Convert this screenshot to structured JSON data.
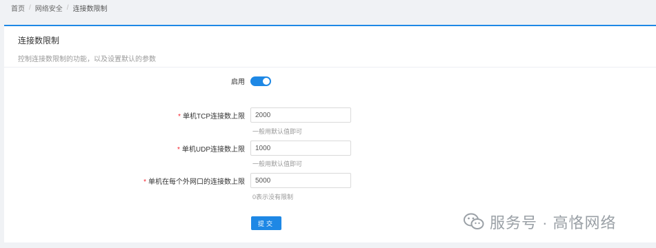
{
  "breadcrumb": {
    "items": [
      "首页",
      "网络安全",
      "连接数限制"
    ],
    "separator": "/"
  },
  "panel": {
    "title": "连接数限制",
    "description": "控制连接数限制的功能，以及设置默认的参数"
  },
  "form": {
    "enable": {
      "label": "启用",
      "value": true
    },
    "tcp": {
      "required_mark": "*",
      "label": "单机TCP连接数上限",
      "value": "2000",
      "hint": "一般用默认值即可"
    },
    "udp": {
      "required_mark": "*",
      "label": "单机UDP连接数上限",
      "value": "1000",
      "hint": "一般用默认值即可"
    },
    "ext": {
      "required_mark": "*",
      "label": "单机在每个外网口的连接数上限",
      "value": "5000",
      "hint": "0表示没有限制"
    },
    "submit_label": "提交"
  },
  "watermark": {
    "text": "服务号 · 高恪网络",
    "icon": "wechat-icon"
  },
  "colors": {
    "accent": "#1e88e5",
    "required": "#f5222d",
    "background": "#f0f2f5"
  }
}
